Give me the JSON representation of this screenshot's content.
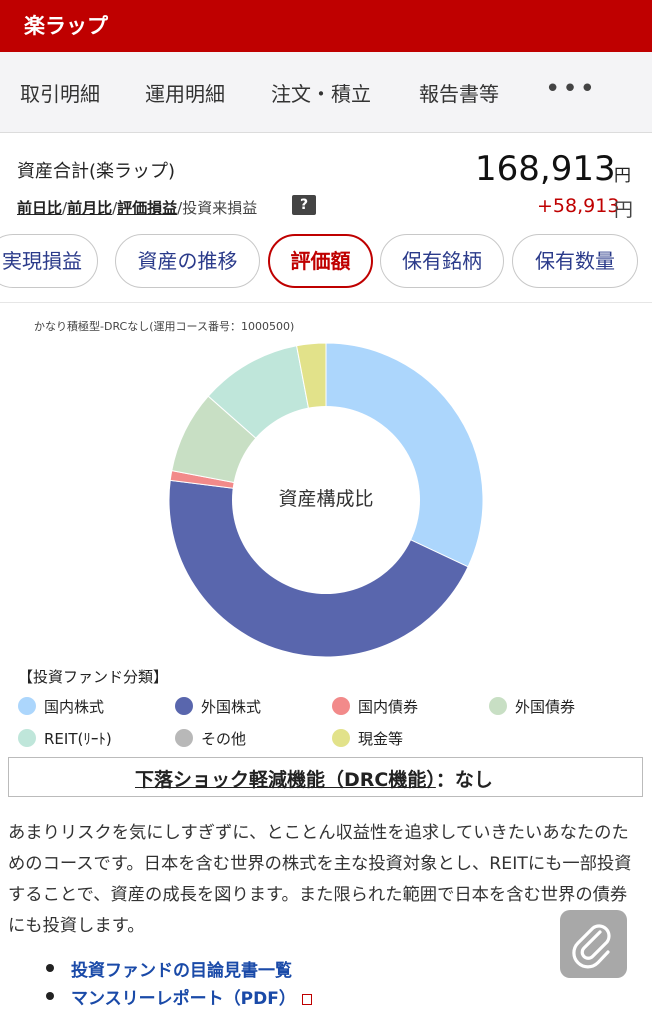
{
  "app": {
    "title": "楽ラップ"
  },
  "nav": {
    "items": [
      "取引明細",
      "運用明細",
      "注文・積立",
      "報告書等"
    ],
    "more": "•••"
  },
  "summary": {
    "label": "資産合計(楽ラップ)",
    "value": "168,913",
    "unit": "円",
    "links": [
      "前日比",
      "前月比",
      "評価損益"
    ],
    "muted_link": "投資来損益",
    "help": "?",
    "gain": "+58,913",
    "gain_unit": "円"
  },
  "tabs": [
    "実現損益",
    "資産の推移",
    "評価額",
    "保有銘柄",
    "保有数量"
  ],
  "active_tab": "評価額",
  "course_note": "かなり積極型-DRCなし(運用コース番号：1000500)",
  "chart_data": {
    "type": "pie",
    "title": "資産構成比",
    "categories": [
      "国内株式",
      "外国株式",
      "国内債券",
      "外国債券",
      "REIT(ﾘｰﾄ)",
      "その他",
      "現金等"
    ],
    "values": [
      32,
      45,
      1,
      8.5,
      10.5,
      0,
      3
    ],
    "colors": [
      "#acd6fc",
      "#5966ad",
      "#f28a8a",
      "#c8dfc4",
      "#bfe6da",
      "#b8b8b8",
      "#e2e28a"
    ]
  },
  "legend": {
    "heading": "【投資ファンド分類】",
    "items": [
      {
        "label": "国内株式",
        "color": "#acd6fc"
      },
      {
        "label": "外国株式",
        "color": "#5966ad"
      },
      {
        "label": "国内債券",
        "color": "#f28a8a"
      },
      {
        "label": "外国債券",
        "color": "#c8dfc4"
      },
      {
        "label": "REIT(ﾘｰﾄ)",
        "color": "#bfe6da"
      },
      {
        "label": "その他",
        "color": "#b8b8b8"
      },
      {
        "label": "現金等",
        "color": "#e2e28a"
      }
    ]
  },
  "drc": {
    "link": "下落ショック軽減機能（DRC機能）",
    "value": "：なし"
  },
  "description": "あまりリスクを気にしすぎずに、とことん収益性を追求していきたいあなたのためのコースです。日本を含む世界の株式を主な投資対象とし、REITにも一部投資することで、資産の成長を図ります。また限られた範囲で日本を含む世界の債券にも投資します。",
  "links": [
    "投資ファンドの目論見書一覧",
    "マンスリーレポート（PDF）"
  ],
  "colors": {
    "brand": "#bf0000",
    "link": "#1a4aa8"
  }
}
